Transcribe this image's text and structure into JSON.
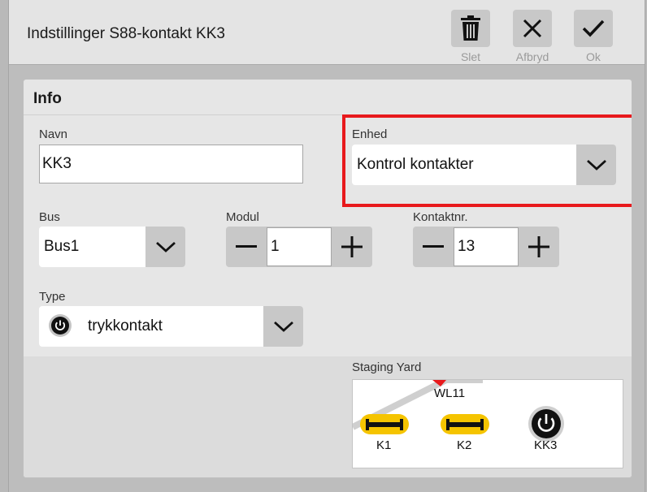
{
  "window": {
    "title": "Indstillinger S88-kontakt KK3"
  },
  "toolbar": {
    "delete_label": "Slet",
    "cancel_label": "Afbryd",
    "ok_label": "Ok"
  },
  "panel": {
    "title": "Info"
  },
  "fields": {
    "name": {
      "label": "Navn",
      "value": "KK3"
    },
    "unit": {
      "label": "Enhed",
      "value": "Kontrol kontakter"
    },
    "bus": {
      "label": "Bus",
      "value": "Bus1"
    },
    "module": {
      "label": "Modul",
      "value": "1"
    },
    "contact_no": {
      "label": "Kontaktnr.",
      "value": "13"
    },
    "type": {
      "label": "Type",
      "value": "trykkontakt",
      "icon": "power-icon"
    }
  },
  "preview": {
    "label": "Staging Yard",
    "items": {
      "switch_label": "WL11",
      "k1_label": "K1",
      "k2_label": "K2",
      "kk3_label": "KK3"
    }
  },
  "colors": {
    "highlight": "#e8191c",
    "sensor": "#f5c400",
    "accent_red": "#e8191c"
  }
}
